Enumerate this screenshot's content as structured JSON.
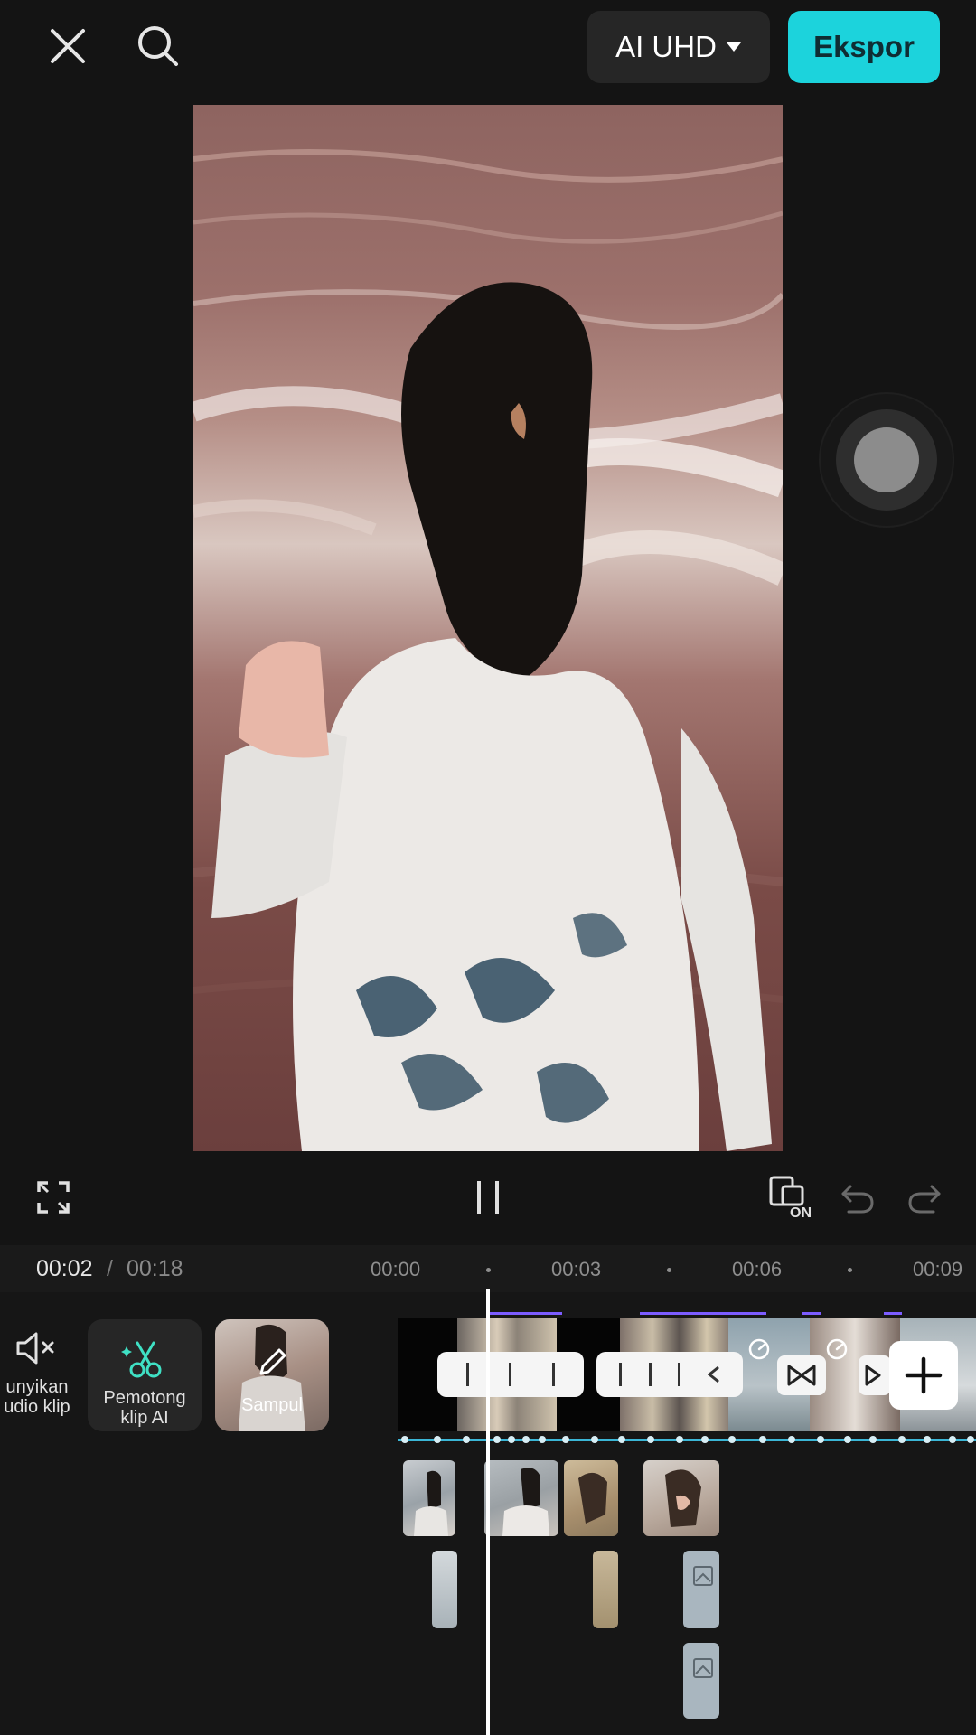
{
  "header": {
    "resolution_label": "AI UHD",
    "export_label": "Ekspor",
    "close_icon": "close-icon",
    "search_icon": "search-icon"
  },
  "controls": {
    "fullscreen_icon": "fullscreen-icon",
    "pause_icon": "pause-icon",
    "keyframe_toggle_label": "ON",
    "undo_icon": "undo-icon",
    "redo_icon": "redo-icon"
  },
  "time": {
    "current": "00:02",
    "separator": "/",
    "total": "00:18",
    "ticks": [
      "00:00",
      "00:03",
      "00:06",
      "00:09"
    ]
  },
  "tools": {
    "mute_label_line1": "unyikan",
    "mute_label_line2": "udio klip",
    "ai_cutter_line1": "Pemotong",
    "ai_cutter_line2": "klip AI",
    "cover_label": "Sampul"
  },
  "colors": {
    "accent": "#1cd3dc",
    "background": "#141414",
    "timeline_line": "#3bb6d6",
    "clip_marker": "#7c5cff"
  }
}
